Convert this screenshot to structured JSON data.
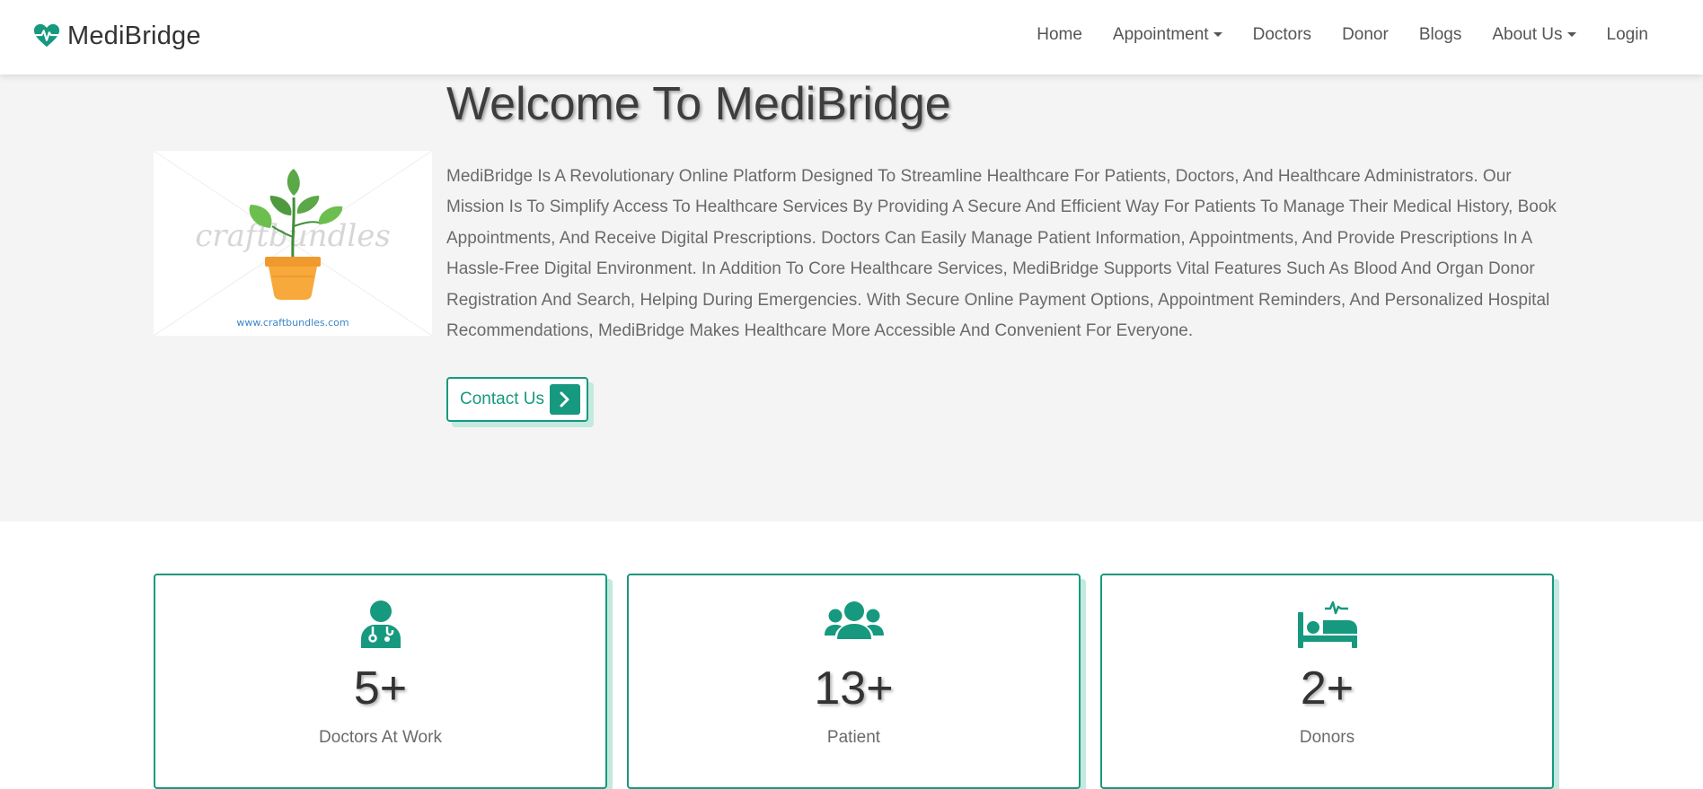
{
  "brand": {
    "name": "MediBridge",
    "icon": "heart-pulse-icon",
    "color": "#16997f"
  },
  "nav": {
    "items": [
      {
        "label": "Home",
        "dropdown": false
      },
      {
        "label": "Appointment",
        "dropdown": true
      },
      {
        "label": "Doctors",
        "dropdown": false
      },
      {
        "label": "Donor",
        "dropdown": false
      },
      {
        "label": "Blogs",
        "dropdown": false
      },
      {
        "label": "About Us",
        "dropdown": true
      },
      {
        "label": "Login",
        "dropdown": false
      }
    ]
  },
  "hero": {
    "title": "Welcome To MediBridge",
    "description": "MediBridge Is A Revolutionary Online Platform Designed To Streamline Healthcare For Patients, Doctors, And Healthcare Administrators. Our Mission Is To Simplify Access To Healthcare Services By Providing A Secure And Efficient Way For Patients To Manage Their Medical History, Book Appointments, And Receive Digital Prescriptions. Doctors Can Easily Manage Patient Information, Appointments, And Provide Prescriptions In A Hassle-Free Digital Environment. In Addition To Core Healthcare Services, MediBridge Supports Vital Features Such As Blood And Organ Donor Registration And Search, Helping During Emergencies. With Secure Online Payment Options, Appointment Reminders, And Personalized Hospital Recommendations, MediBridge Makes Healthcare More Accessible And Convenient For Everyone.",
    "image": {
      "watermark": "craftbundles",
      "url_text": "www.craftbundles.com"
    },
    "cta_label": "Contact Us"
  },
  "stats": [
    {
      "icon": "doctor-icon",
      "value": "5+",
      "label": "Doctors At Work"
    },
    {
      "icon": "users-icon",
      "value": "13+",
      "label": "Patient"
    },
    {
      "icon": "hospital-bed-icon",
      "value": "2+",
      "label": "Donors"
    }
  ],
  "colors": {
    "accent": "#16997f",
    "accent_shadow": "#c4e9df",
    "hero_bg": "#f4f4f4"
  }
}
